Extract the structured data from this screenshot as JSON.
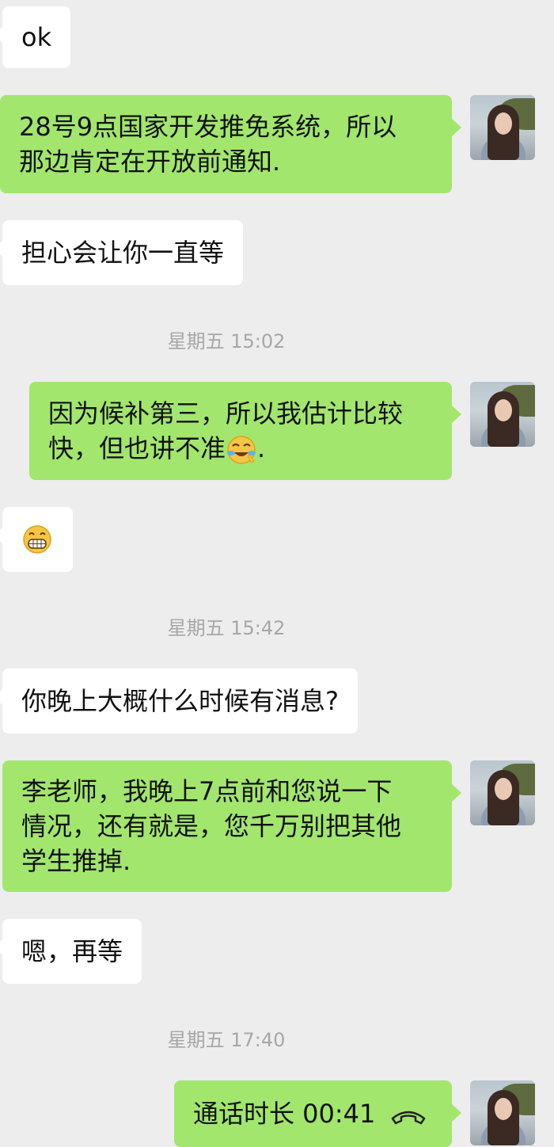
{
  "messages": [
    {
      "side": "in",
      "text": "ok"
    },
    {
      "side": "out",
      "text": "28号9点国家开发推免系统，所以\n那边肯定在开放前通知."
    },
    {
      "side": "in",
      "text": "担心会让你一直等"
    },
    {
      "timestamp": "星期五 15:02"
    },
    {
      "side": "out",
      "text_before": "因为候补第三，所以我估计比较\n快，但也讲不准",
      "emoji": "face-with-tears-of-joy-icon",
      "text_after": "."
    },
    {
      "side": "in",
      "emoji": "grinning-face-icon"
    },
    {
      "timestamp": "星期五 15:42"
    },
    {
      "side": "in",
      "text": "你晚上大概什么时候有消息?"
    },
    {
      "side": "out",
      "text": "李老师，我晚上7点前和您说一下\n情况，还有就是，您千万别把其他\n学生推掉."
    },
    {
      "side": "in",
      "text": "嗯，再等"
    },
    {
      "timestamp": "星期五 17:40"
    },
    {
      "side": "out",
      "type": "call",
      "text": "通话时长 00:41",
      "icon": "phone-hangup-icon"
    }
  ],
  "colors": {
    "background": "#ededed",
    "incoming_bubble": "#ffffff",
    "outgoing_bubble": "#a2e66d",
    "timestamp": "#a7a7a7"
  }
}
